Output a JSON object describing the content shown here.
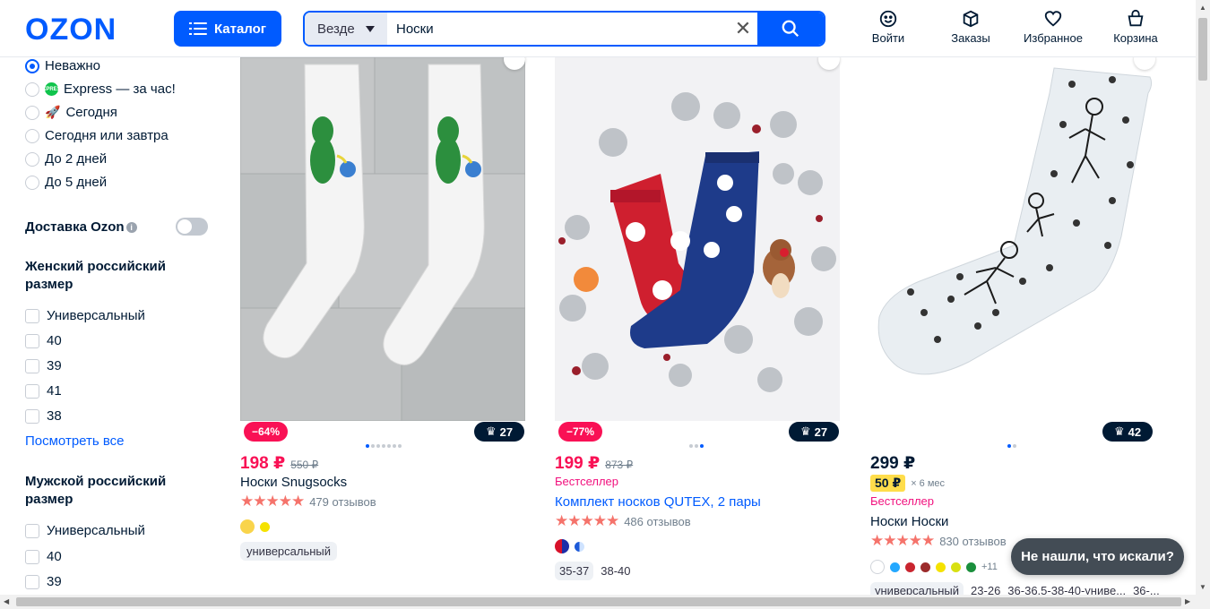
{
  "header": {
    "logo": "OZON",
    "catalog_label": "Каталог",
    "search_scope": "Везде",
    "search_value": "Носки",
    "nav": [
      {
        "label": "Войти",
        "icon": "smile-icon"
      },
      {
        "label": "Заказы",
        "icon": "box-icon"
      },
      {
        "label": "Избранное",
        "icon": "heart-icon"
      },
      {
        "label": "Корзина",
        "icon": "cart-icon"
      }
    ]
  },
  "sidebar": {
    "delivery_options": [
      {
        "label": "Неважно",
        "selected": true
      },
      {
        "label": "Express — за час!",
        "selected": false,
        "badge": "EXPRESS"
      },
      {
        "label": "Сегодня",
        "selected": false
      },
      {
        "label": "Сегодня или завтра",
        "selected": false
      },
      {
        "label": "До 2 дней",
        "selected": false
      },
      {
        "label": "До 5 дней",
        "selected": false
      }
    ],
    "ozon_delivery_label": "Доставка Ozon",
    "ozon_delivery_info": "i",
    "women_size_title": "Женский российский размер",
    "women_sizes": [
      "Универсальный",
      "40",
      "39",
      "41",
      "38"
    ],
    "show_all": "Посмотреть все",
    "men_size_title": "Мужской российский размер",
    "men_sizes": [
      "Универсальный",
      "40",
      "39"
    ]
  },
  "products": [
    {
      "discount": "−64%",
      "crown_count": "27",
      "price": "198 ₽",
      "old_price": "550 ₽",
      "title": "Носки Snugsocks",
      "reviews": "479 отзывов",
      "stars": "★★★★★",
      "more": "•••",
      "swatches": [
        "#f9d44b",
        "#f5e200"
      ],
      "chip": "универсальный",
      "dots_total": 7,
      "dots_active": 0
    },
    {
      "discount": "−77%",
      "crown_count": "27",
      "price": "199 ₽",
      "old_price": "873 ₽",
      "badge": "Бестселлер",
      "title": "Комплект носков QUTEX, 2 пары",
      "reviews": "486 отзывов",
      "stars": "★★★★★",
      "more": "•••",
      "sizes": [
        "35-37",
        "38-40"
      ],
      "dots_total": 3,
      "dots_active": 2
    },
    {
      "crown_count": "42",
      "price": "299 ₽",
      "installment": "50 ₽",
      "installment_term": "× 6 мес",
      "badge": "Бестселлер",
      "title": "Носки Носки",
      "reviews": "830 отзывов",
      "stars": "★★★★★",
      "more": "•••",
      "swatches": [
        "#ffffff",
        "#24a8ff",
        "#c9252f",
        "#9b2b2b",
        "#f5e200",
        "#d8e012",
        "#1a8f3c"
      ],
      "swatch_more": "+11",
      "sizes": [
        "универсальный",
        "23-26",
        "36-36.5-38-40-униве...",
        "36-..."
      ],
      "dots_total": 2,
      "dots_active": 0
    }
  ],
  "help_button": "Не нашли, что искали?",
  "colors": {
    "brand": "#005bff",
    "sale": "#f91155",
    "bestseller": "#f1117e"
  }
}
